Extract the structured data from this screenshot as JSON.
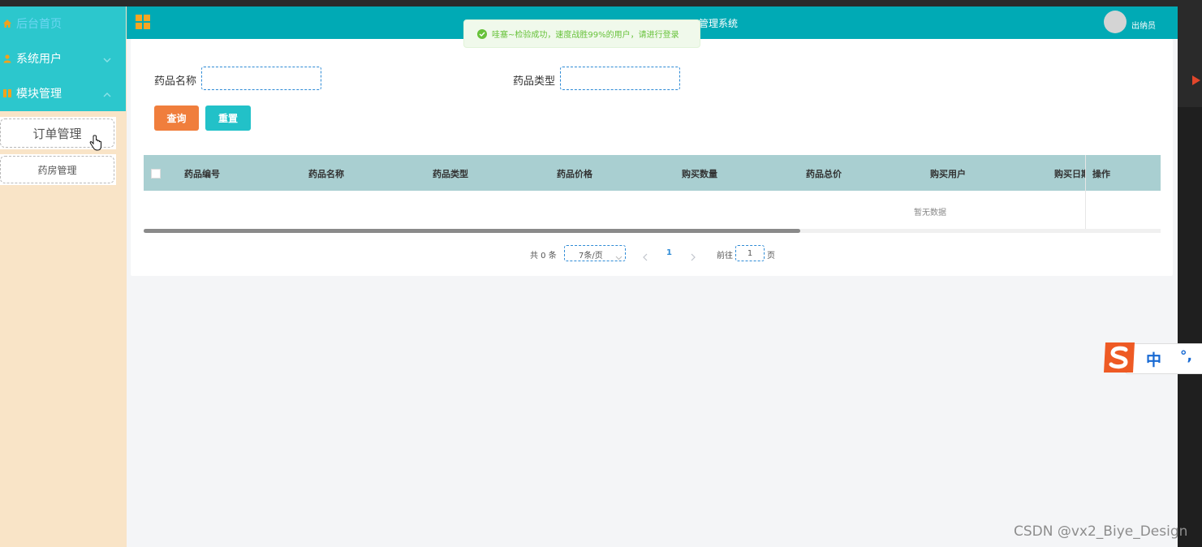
{
  "sidebar": {
    "items": [
      {
        "label": "后台首页",
        "icon": "home-icon"
      },
      {
        "label": "系统用户",
        "icon": "user-icon"
      },
      {
        "label": "模块管理",
        "icon": "module-icon"
      }
    ],
    "sub_items": [
      "订单管理",
      "药房管理"
    ]
  },
  "header": {
    "title": "管理系统",
    "logout_label": "出纳员",
    "menu_icon": "grid-icon"
  },
  "toast": {
    "message": "哇塞~检验成功，速度战胜99%的用户，请进行登录",
    "icon": "check-circle-icon"
  },
  "search": {
    "name_label": "药品名称",
    "name_value": "",
    "type_label": "药品类型",
    "type_value": "",
    "query_label": "查询",
    "reset_label": "重置"
  },
  "table": {
    "columns": [
      "药品编号",
      "药品名称",
      "药品类型",
      "药品价格",
      "购买数量",
      "药品总价",
      "购买用户",
      "购买日期",
      "操作"
    ],
    "empty_text": "暂无数据"
  },
  "pagination": {
    "total": "共 0 条",
    "page_size": "7条/页",
    "current_page": "1",
    "goto_label": "前往",
    "goto_value": "1",
    "page_suffix": "页"
  },
  "ime": {
    "label": "中",
    "punct": "°,"
  },
  "watermark": "CSDN @vx2_Biye_Design",
  "colors": {
    "sidebar_accent": "#2cc7cd",
    "header_bg": "#00aab5",
    "query_button": "#f07e3c",
    "reset_button": "#22c1c8",
    "table_header": "#a9cfd1",
    "sidebar_bg": "#f9e4c7"
  }
}
